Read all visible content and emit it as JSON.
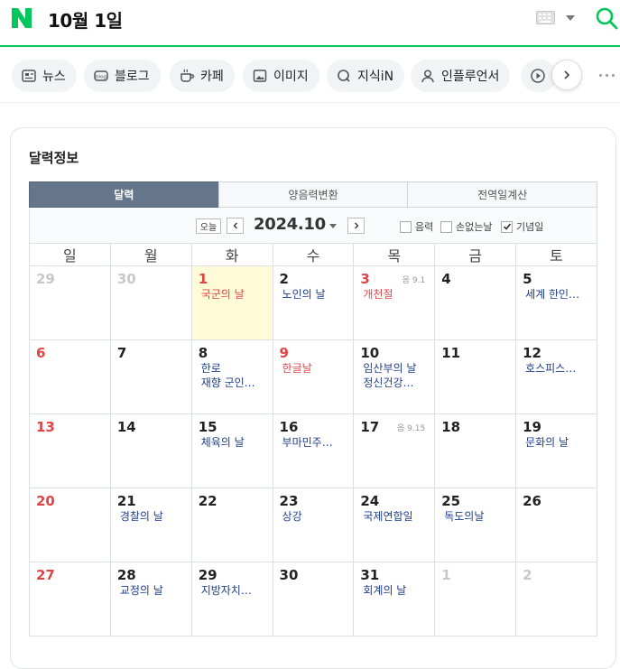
{
  "header": {
    "query": "10월 1일",
    "brand_color": "#03c75a"
  },
  "tabs": [
    {
      "label": "뉴스",
      "icon": "news-icon"
    },
    {
      "label": "블로그",
      "icon": "blog-icon"
    },
    {
      "label": "카페",
      "icon": "cafe-icon"
    },
    {
      "label": "이미지",
      "icon": "image-icon"
    },
    {
      "label": "지식iN",
      "icon": "kin-icon"
    },
    {
      "label": "인플루언서",
      "icon": "influencer-icon"
    }
  ],
  "card": {
    "title": "달력정보",
    "tabs": [
      "달력",
      "양음력변환",
      "전역일계산"
    ],
    "active_tab": 0,
    "today_label": "오늘",
    "year_month": "2024.10",
    "options": [
      {
        "label": "음력",
        "checked": false
      },
      {
        "label": "손없는날",
        "checked": false
      },
      {
        "label": "기념일",
        "checked": true
      }
    ]
  },
  "calendar": {
    "weekdays": [
      "일",
      "월",
      "화",
      "수",
      "목",
      "금",
      "토"
    ],
    "weeks": [
      [
        {
          "day": "29",
          "kind": "gray",
          "events": []
        },
        {
          "day": "30",
          "kind": "gray",
          "events": []
        },
        {
          "day": "1",
          "kind": "red",
          "today": true,
          "events": [
            {
              "text": "국군의 날",
              "red": true
            }
          ]
        },
        {
          "day": "2",
          "kind": "normal",
          "events": [
            {
              "text": "노인의 날",
              "red": false
            }
          ]
        },
        {
          "day": "3",
          "kind": "red",
          "lunar": "음 9.1",
          "events": [
            {
              "text": "개천절",
              "red": true
            }
          ]
        },
        {
          "day": "4",
          "kind": "normal",
          "events": []
        },
        {
          "day": "5",
          "kind": "normal",
          "events": [
            {
              "text": "세계 한인…",
              "red": false
            }
          ]
        }
      ],
      [
        {
          "day": "6",
          "kind": "red",
          "events": []
        },
        {
          "day": "7",
          "kind": "normal",
          "events": []
        },
        {
          "day": "8",
          "kind": "normal",
          "events": [
            {
              "text": "한로",
              "red": false
            },
            {
              "text": "재향 군인…",
              "red": false
            }
          ]
        },
        {
          "day": "9",
          "kind": "red",
          "events": [
            {
              "text": "한글날",
              "red": true
            }
          ]
        },
        {
          "day": "10",
          "kind": "normal",
          "events": [
            {
              "text": "임산부의 날",
              "red": false
            },
            {
              "text": "정신건강…",
              "red": false
            }
          ]
        },
        {
          "day": "11",
          "kind": "normal",
          "events": []
        },
        {
          "day": "12",
          "kind": "normal",
          "events": [
            {
              "text": "호스피스…",
              "red": false
            }
          ]
        }
      ],
      [
        {
          "day": "13",
          "kind": "red",
          "events": []
        },
        {
          "day": "14",
          "kind": "normal",
          "events": []
        },
        {
          "day": "15",
          "kind": "normal",
          "events": [
            {
              "text": "체육의 날",
              "red": false
            }
          ]
        },
        {
          "day": "16",
          "kind": "normal",
          "events": [
            {
              "text": "부마민주…",
              "red": false
            }
          ]
        },
        {
          "day": "17",
          "kind": "normal",
          "lunar": "음 9.15",
          "events": []
        },
        {
          "day": "18",
          "kind": "normal",
          "events": []
        },
        {
          "day": "19",
          "kind": "normal",
          "events": [
            {
              "text": "문화의 날",
              "red": false
            }
          ]
        }
      ],
      [
        {
          "day": "20",
          "kind": "red",
          "events": []
        },
        {
          "day": "21",
          "kind": "normal",
          "events": [
            {
              "text": "경찰의 날",
              "red": false
            }
          ]
        },
        {
          "day": "22",
          "kind": "normal",
          "events": []
        },
        {
          "day": "23",
          "kind": "normal",
          "events": [
            {
              "text": "상강",
              "red": false
            }
          ]
        },
        {
          "day": "24",
          "kind": "normal",
          "events": [
            {
              "text": "국제연합일",
              "red": false
            }
          ]
        },
        {
          "day": "25",
          "kind": "normal",
          "events": [
            {
              "text": "독도의날",
              "red": false
            }
          ]
        },
        {
          "day": "26",
          "kind": "normal",
          "events": []
        }
      ],
      [
        {
          "day": "27",
          "kind": "red",
          "events": []
        },
        {
          "day": "28",
          "kind": "normal",
          "events": [
            {
              "text": "교정의 날",
              "red": false
            }
          ]
        },
        {
          "day": "29",
          "kind": "normal",
          "events": [
            {
              "text": "지방자치…",
              "red": false
            }
          ]
        },
        {
          "day": "30",
          "kind": "normal",
          "events": []
        },
        {
          "day": "31",
          "kind": "normal",
          "events": [
            {
              "text": "회계의 날",
              "red": false
            }
          ]
        },
        {
          "day": "1",
          "kind": "gray",
          "events": []
        },
        {
          "day": "2",
          "kind": "gray",
          "events": []
        }
      ]
    ]
  }
}
